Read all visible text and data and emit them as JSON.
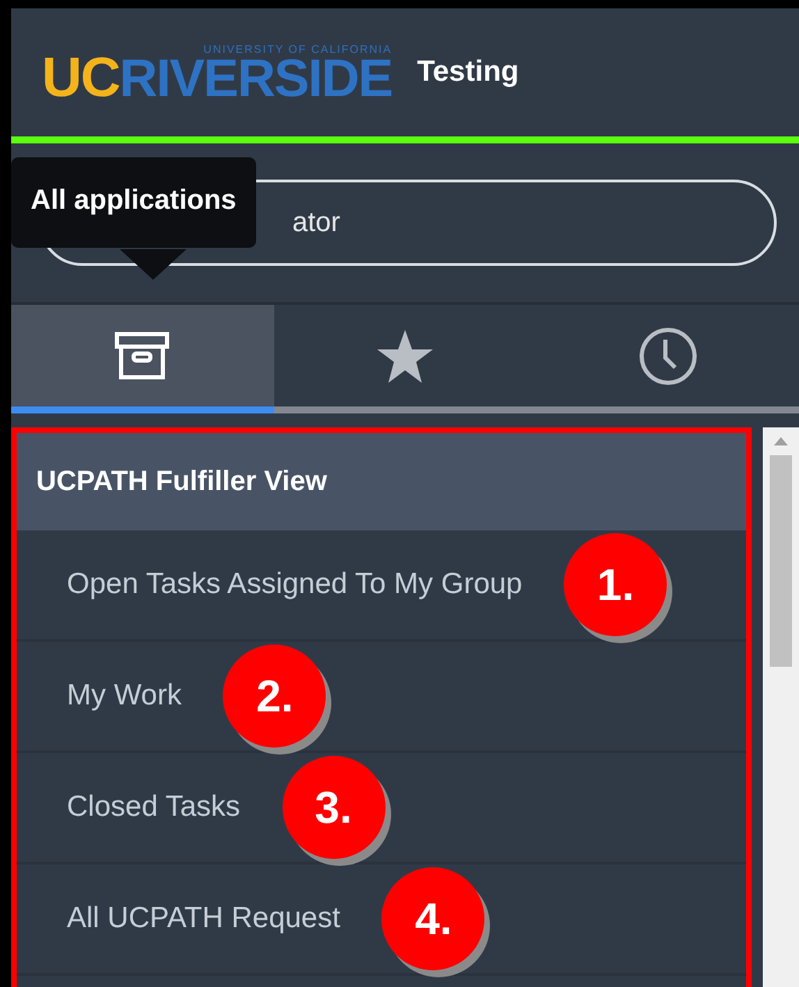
{
  "header": {
    "logo": {
      "uc": "UC",
      "name": "RIVERSIDE",
      "tagline": "UNIVERSITY OF CALIFORNIA"
    },
    "instance": "Testing"
  },
  "search": {
    "placeholder": "ator"
  },
  "tooltip": {
    "text": "All applications"
  },
  "tabs": [
    {
      "kind": "archive",
      "selected": true
    },
    {
      "kind": "star",
      "selected": false
    },
    {
      "kind": "clock",
      "selected": false
    }
  ],
  "menu": {
    "title": "UCPATH Fulfiller View",
    "items": [
      {
        "label": "Open Tasks Assigned To My Group",
        "callout": "1."
      },
      {
        "label": "My Work",
        "callout": "2."
      },
      {
        "label": "Closed Tasks",
        "callout": "3."
      },
      {
        "label": "All UCPATH Request",
        "callout": "4."
      }
    ]
  }
}
